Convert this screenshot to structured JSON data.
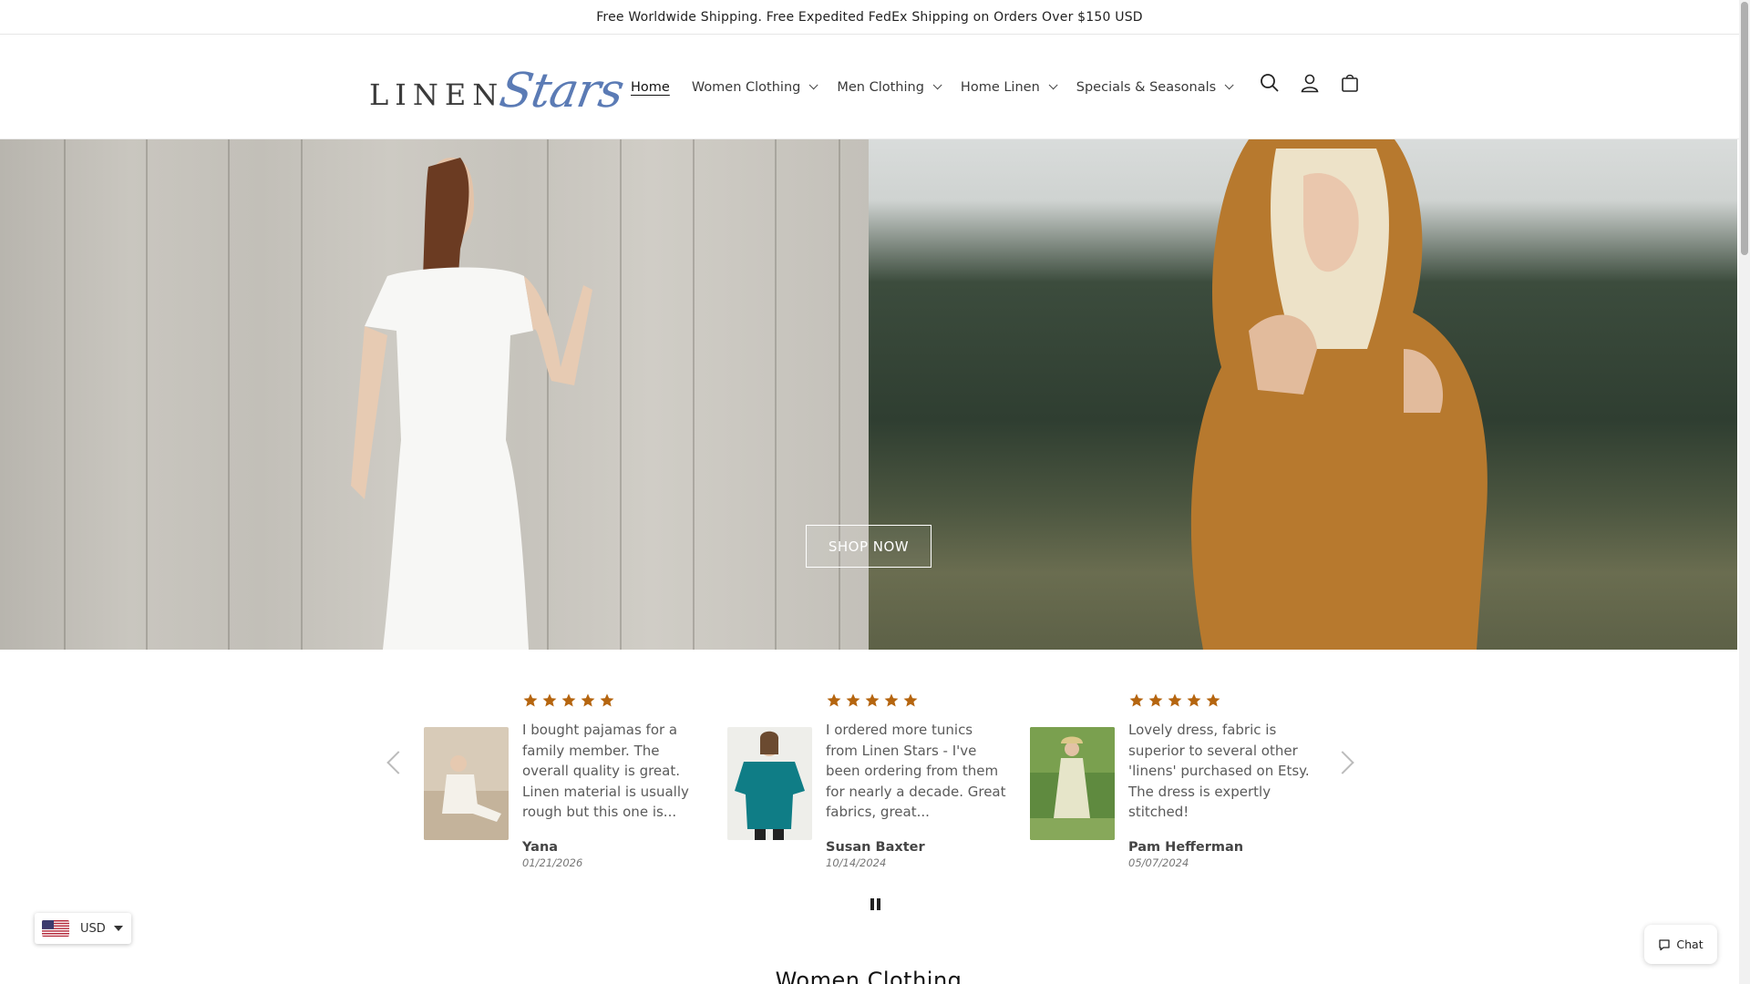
{
  "announcement": "Free Worldwide Shipping. Free Expedited FedEx Shipping on Orders Over $150 USD",
  "logo": {
    "part1": "LINEN",
    "part2": "Stars"
  },
  "nav": {
    "items": [
      {
        "label": "Home"
      },
      {
        "label": "Women Clothing"
      },
      {
        "label": "Men Clothing"
      },
      {
        "label": "Home Linen"
      },
      {
        "label": "Specials & Seasonals"
      }
    ]
  },
  "header_icons": [
    "search-icon",
    "account-icon",
    "cart-icon"
  ],
  "hero": {
    "cta": "SHOP NOW"
  },
  "reviews": [
    {
      "rating": 5,
      "text": "I bought pajamas for a family member. The overall quality is great. Linen material is usually rough but this one is...",
      "name": "Yana",
      "date": "01/21/2026"
    },
    {
      "rating": 5,
      "text": "I ordered more tunics from Linen Stars - I've been ordering from them for nearly a decade. Great fabrics, great...",
      "name": "Susan Baxter",
      "date": "10/14/2024"
    },
    {
      "rating": 5,
      "text": "Lovely dress, fabric is superior to several other 'linens' purchased on Etsy. The dress is expertly stitched!",
      "name": "Pam Hefferman",
      "date": "05/07/2024"
    }
  ],
  "section_title": "Women Clothing",
  "currency": {
    "code": "USD"
  },
  "chat": {
    "label": "Chat"
  },
  "colors": {
    "star": "#b5650f",
    "logo_script": "#5b7bb5"
  }
}
